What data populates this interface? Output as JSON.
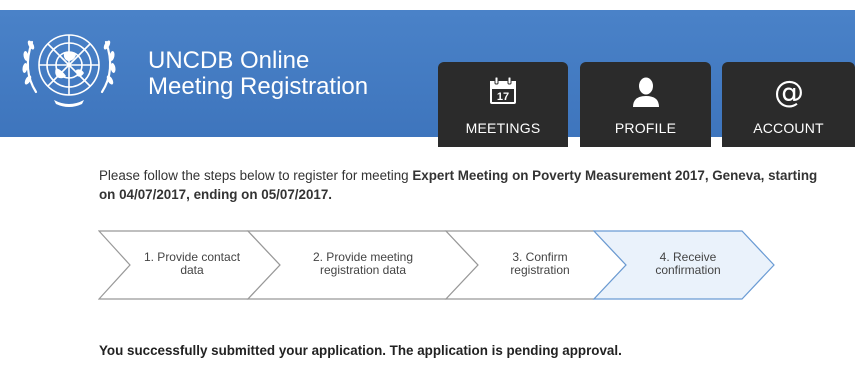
{
  "header": {
    "title_line1": "UNCDB Online",
    "title_line2": "Meeting Registration",
    "bg_color": "#4179c2"
  },
  "nav": {
    "tabs": [
      {
        "label": "MEETINGS",
        "icon": "calendar-icon",
        "icon_text": "17"
      },
      {
        "label": "PROFILE",
        "icon": "user-icon"
      },
      {
        "label": "ACCOUNT",
        "icon": "at-icon",
        "icon_text": "@"
      }
    ]
  },
  "intro": {
    "prefix": "Please follow the steps below to register for meeting ",
    "meeting_name": "Expert Meeting on Poverty Measurement 2017, Geneva",
    "middle1": ", starting on ",
    "start_date": "04/07/2017",
    "middle2": ", ending on ",
    "end_date": "05/07/2017",
    "suffix": "."
  },
  "steps": [
    {
      "line1": "1. Provide contact",
      "line2": "data",
      "active": false
    },
    {
      "line1": "2. Provide meeting",
      "line2": "registration data",
      "active": false
    },
    {
      "line1": "3. Confirm",
      "line2": "registration",
      "active": false
    },
    {
      "line1": "4. Receive",
      "line2": "confirmation",
      "active": true
    }
  ],
  "colors": {
    "step_border": "#999999",
    "step_active_fill": "#eaf2fb",
    "step_active_border": "#6a9bd4"
  },
  "result_message": "You successfully submitted your application. The application is pending approval."
}
